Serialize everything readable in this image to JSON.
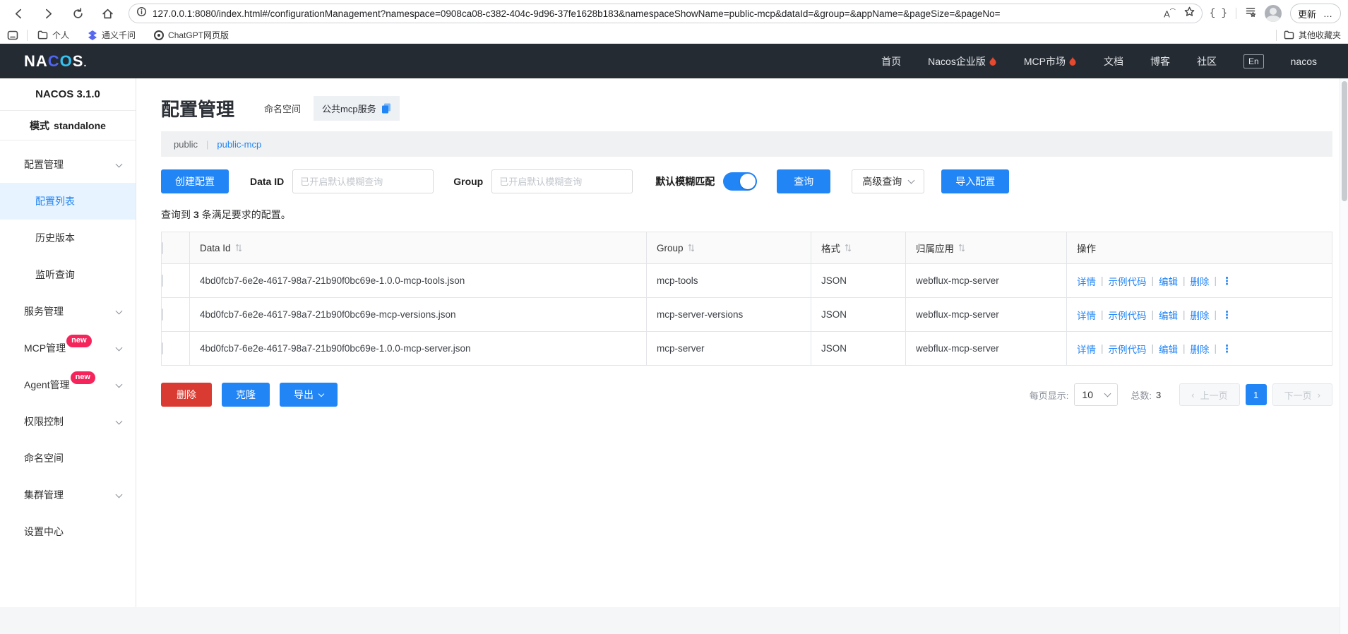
{
  "colors": {
    "accent_blue": "#2285f6",
    "danger_red": "#d93a31",
    "header_dark": "#252b33",
    "badge_red": "#f5255c",
    "selected_item_bg": "#e7f3fe",
    "toggle_on": "#2285f6"
  },
  "browser": {
    "url": "127.0.0.1:8080/index.html#/configurationManagement?namespace=0908ca08-c382-404c-9d96-37fe1628b183&namespaceShowName=public-mcp&dataId=&group=&appName=&pageSize=&pageNo=",
    "update_label": "更新",
    "more_label": "…",
    "bookmarks": {
      "personal": "个人",
      "tongyi": "通义千问",
      "chatgpt": "ChatGPT网页版",
      "others": "其他收藏夹"
    }
  },
  "topnav": {
    "logo": "NACOS.",
    "items": [
      {
        "label": "首页"
      },
      {
        "label": "Nacos企业版",
        "hot": true
      },
      {
        "label": "MCP市场",
        "hot": true
      },
      {
        "label": "文档"
      },
      {
        "label": "博客"
      },
      {
        "label": "社区"
      }
    ],
    "lang": "En",
    "user": "nacos"
  },
  "sidebar": {
    "version": "NACOS 3.1.0",
    "mode_label": "模式",
    "mode_value": "standalone",
    "items": [
      {
        "label": "配置管理"
      },
      {
        "label": "配置列表",
        "selected": true
      },
      {
        "label": "历史版本"
      },
      {
        "label": "监听查询"
      },
      {
        "label": "服务管理"
      },
      {
        "label": "MCP管理",
        "badge": "new"
      },
      {
        "label": "Agent管理",
        "badge": "new"
      },
      {
        "label": "权限控制"
      },
      {
        "label": "命名空间"
      },
      {
        "label": "集群管理"
      },
      {
        "label": "设置中心"
      }
    ]
  },
  "page": {
    "title": "配置管理",
    "namespace_label": "命名空间",
    "namespace_tag": "公共mcp服务",
    "breadcrumb": {
      "parent": "public",
      "divider": "|",
      "current": "public-mcp"
    },
    "toolbar": {
      "create": "创建配置",
      "data_id_label": "Data ID",
      "data_id_placeholder": "已开启默认模糊查询",
      "group_label": "Group",
      "group_placeholder": "已开启默认模糊查询",
      "fuzzy_label": "默认模糊匹配",
      "search": "查询",
      "advanced": "高级查询",
      "import": "导入配置"
    },
    "result": {
      "prefix": "查询到",
      "count": "3",
      "suffix": "条满足要求的配置。"
    },
    "table": {
      "headers": [
        "Data Id",
        "Group",
        "格式",
        "归属应用",
        "操作"
      ],
      "ops": {
        "detail": "详情",
        "sample": "示例代码",
        "edit": "编辑",
        "delete": "删除",
        "sep": "|",
        "more": "⋮"
      },
      "rows": [
        {
          "data_id": "4bd0fcb7-6e2e-4617-98a7-21b90f0bc69e-1.0.0-mcp-tools.json",
          "group": "mcp-tools",
          "format": "JSON",
          "app": "webflux-mcp-server"
        },
        {
          "data_id": "4bd0fcb7-6e2e-4617-98a7-21b90f0bc69e-mcp-versions.json",
          "group": "mcp-server-versions",
          "format": "JSON",
          "app": "webflux-mcp-server"
        },
        {
          "data_id": "4bd0fcb7-6e2e-4617-98a7-21b90f0bc69e-1.0.0-mcp-server.json",
          "group": "mcp-server",
          "format": "JSON",
          "app": "webflux-mcp-server"
        }
      ]
    },
    "actions": {
      "delete": "删除",
      "clone": "克隆",
      "export": "导出"
    },
    "pagination": {
      "page_size_label": "每页显示:",
      "page_size": "10",
      "total_label": "总数:",
      "total": "3",
      "prev_arrow": "‹",
      "prev": "上一页",
      "current": "1",
      "next": "下一页",
      "next_arrow": "›"
    }
  }
}
